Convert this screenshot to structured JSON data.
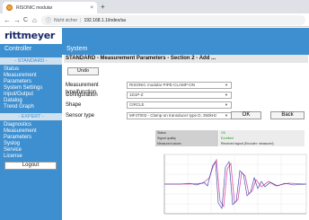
{
  "browser": {
    "tab_title": "RISONIC modular",
    "tab_close": "×",
    "new_tab": "+",
    "nav": {
      "back": "←",
      "forward": "→",
      "reload": "C",
      "home": "⌂"
    },
    "security_label": "Nicht sicher",
    "url": "192.168.1.1/index/sa"
  },
  "header": {
    "logo": "rittmeyer",
    "controller_label": "Controller",
    "system_label": "System"
  },
  "sidebar": {
    "sections": [
      {
        "heading": "- STANDARD -",
        "items": [
          "Status",
          "Measurement Parameters",
          "System Settings",
          "Input/Output",
          "Datalog",
          "Trend Graph"
        ]
      },
      {
        "heading": "- EXPERT -",
        "items": [
          "Diagnostics",
          "Measurement Parameters",
          "Syslog",
          "Service",
          "License"
        ]
      }
    ],
    "logout_label": "Logout"
  },
  "main": {
    "title": "STANDARD - Measurement Parameters - Section 2 - Add ...",
    "undo_label": "Undo",
    "fields": [
      {
        "label": "Measurement type/function",
        "value": "RISONIC modular PIPE-CLAMP-ON"
      },
      {
        "label": "Configuration",
        "value": "1D1P-Z"
      },
      {
        "label": "Shape",
        "value": "CIRCLE"
      },
      {
        "label": "Sensor type",
        "value": "MF4T002 - Clamp-on transducer type D, 350kHz"
      }
    ],
    "ok_label": "OK",
    "back_label": "Back",
    "status": [
      {
        "key": "Status",
        "value": "OK"
      },
      {
        "key": "Signal quality",
        "value": "Excellent"
      },
      {
        "key": "Measured values",
        "value": "Received signal (Encoder: measured)"
      }
    ],
    "colors": {
      "brand": "#3d8fd0",
      "status_ok": "#2a9d2a",
      "signal": "#2f3aa8",
      "envelope": "#e04fa0"
    }
  }
}
